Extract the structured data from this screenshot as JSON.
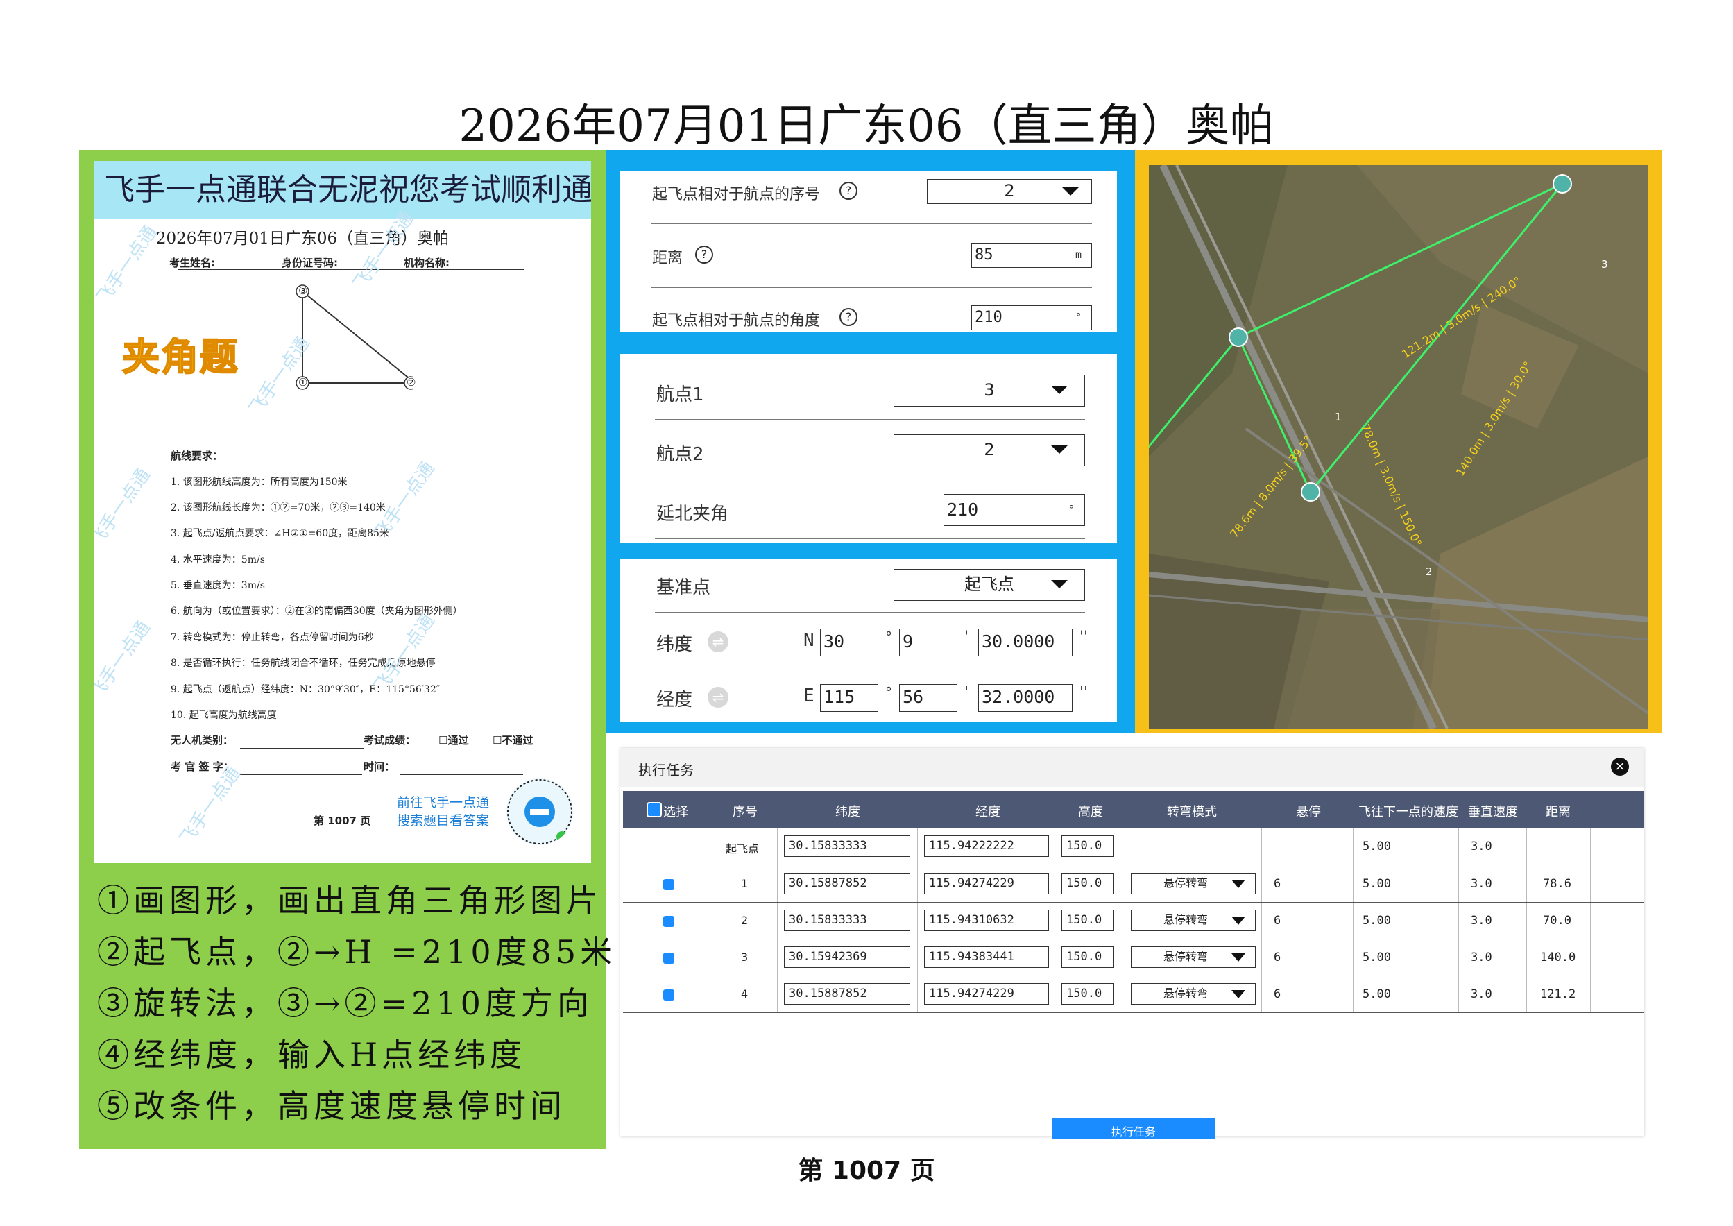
{
  "page": {
    "title": "2026年07月01日广东06（直三角）奥帕",
    "footer": "第 1007 页"
  },
  "exam_sheet": {
    "banner": "飞手一点通联合无泥祝您考试顺利通过",
    "title": "2026年07月01日广东06（直三角）奥帕",
    "fields": [
      "考生姓名:",
      "身份证号码:",
      "机构名称:"
    ],
    "angle_label": "夹角题",
    "diagram_points": [
      "③",
      "①",
      "②"
    ],
    "route_heading": "航线要求：",
    "requirements": [
      "1.  该图形航线高度为：所有高度为150米",
      "2.  该图形航线长度为：①②=70米，②③=140米",
      "3.  起飞点/返航点要求：∠H②①=60度，距离85米",
      "4.  水平速度为：5m/s",
      "5.  垂直速度为：3m/s",
      "6.  航向为（或位置要求）：②在③的南偏西30度（夹角为图形外侧）",
      "7.  转弯模式为：停止转弯，各点停留时间为6秒",
      "8.  是否循环执行：任务航线闭合不循环，任务完成后原地悬停",
      "9.  起飞点（返航点）经纬度：N：30°9′30″，E：115°56′32″",
      "10. 起飞高度为航线高度"
    ],
    "sign_uav": "无人机类别：",
    "sign_result": "考试成绩：",
    "pass": "☐通过",
    "fail": "☐不通过",
    "sign_examiner": "考 官 签 字：",
    "sign_time": "时间：",
    "promo1": "前往飞手一点通",
    "promo2": "搜索题目看答案",
    "page_no": "第 1007 页",
    "watermark": "飞手一点通"
  },
  "steps": [
    "①画图形，画出直角三角形图片",
    "②起飞点，②→H =210度85米",
    "③旋转法，③→②=210度方向",
    "④经纬度，输入H点经纬度",
    "⑤改条件，高度速度悬停时间"
  ],
  "takeoff_form": {
    "seq_label": "起飞点相对于航点的序号",
    "seq_value": "2",
    "distance_label": "距离",
    "distance_value": "85",
    "distance_unit": "m",
    "angle_label": "起飞点相对于航点的角度",
    "angle_value": "210",
    "angle_unit": "°",
    "help_icon": "?"
  },
  "rotate_form": {
    "wp1_label": "航点1",
    "wp1_value": "3",
    "wp2_label": "航点2",
    "wp2_value": "2",
    "north_angle_label": "延北夹角",
    "north_angle_value": "210",
    "angle_unit": "°"
  },
  "coord_form": {
    "ref_label": "基准点",
    "ref_value": "起飞点",
    "lat_label": "纬度",
    "lat_prefix": "N",
    "lat_deg": "30",
    "lat_min": "9",
    "lat_sec": "30.0000",
    "lon_label": "经度",
    "lon_prefix": "E",
    "lon_deg": "115",
    "lon_min": "56",
    "lon_sec": "32.0000",
    "deg_sym": "°",
    "min_sym": "'",
    "sec_sym": "''"
  },
  "map": {
    "marker_labels": [
      "1",
      "2",
      "3"
    ],
    "leg_labels": [
      "78.6m | 8.0m/s | 39.5°",
      "121.2m | 3.0m/s | 240.0°",
      "78.0m | 3.0m/s | 150.0°",
      "140.0m | 3.0m/s | 30.0°"
    ],
    "colors": {
      "route": "#3ef06a",
      "label": "#f5d21a",
      "frame": "#f6c018",
      "terrain": "#6e6a4c"
    }
  },
  "task_table": {
    "title": "执行任务",
    "close_icon": "×",
    "columns": [
      "选择",
      "序号",
      "纬度",
      "经度",
      "高度",
      "转弯模式",
      "悬停",
      "飞往下一点的速度",
      "垂直速度",
      "距离"
    ],
    "rows": [
      {
        "seq": "起飞点",
        "lat": "30.15833333",
        "lon": "115.94222222",
        "alt": "150.0",
        "turn": "",
        "hover": "",
        "speed": "5.00",
        "vspeed": "3.0",
        "dist": ""
      },
      {
        "seq": "1",
        "lat": "30.15887852",
        "lon": "115.94274229",
        "alt": "150.0",
        "turn": "悬停转弯",
        "hover": "6",
        "speed": "5.00",
        "vspeed": "3.0",
        "dist": "78.6"
      },
      {
        "seq": "2",
        "lat": "30.15833333",
        "lon": "115.94310632",
        "alt": "150.0",
        "turn": "悬停转弯",
        "hover": "6",
        "speed": "5.00",
        "vspeed": "3.0",
        "dist": "70.0"
      },
      {
        "seq": "3",
        "lat": "30.15942369",
        "lon": "115.94383441",
        "alt": "150.0",
        "turn": "悬停转弯",
        "hover": "6",
        "speed": "5.00",
        "vspeed": "3.0",
        "dist": "140.0"
      },
      {
        "seq": "4",
        "lat": "30.15887852",
        "lon": "115.94274229",
        "alt": "150.0",
        "turn": "悬停转弯",
        "hover": "6",
        "speed": "5.00",
        "vspeed": "3.0",
        "dist": "121.2"
      }
    ],
    "exec_button": "执行任务"
  }
}
